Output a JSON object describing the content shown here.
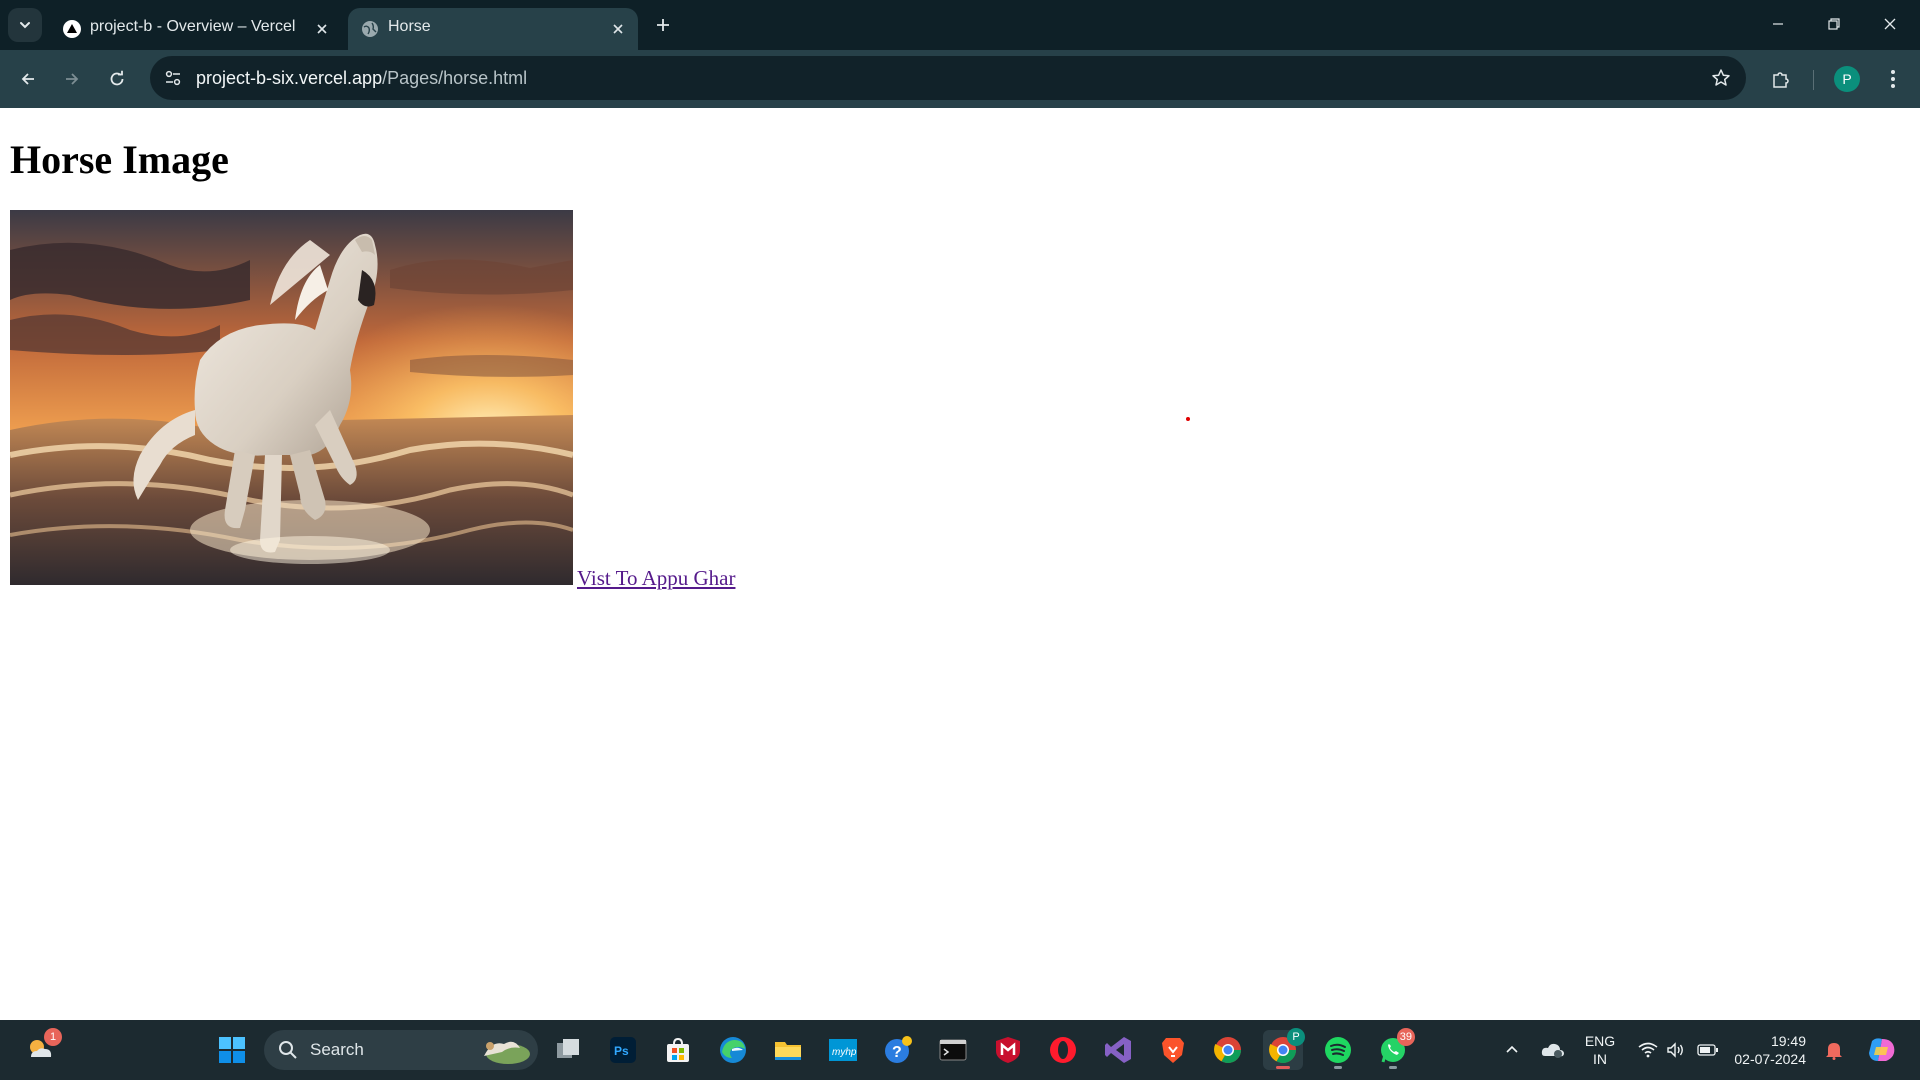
{
  "browser": {
    "tabs": [
      {
        "title": "project-b - Overview – Vercel",
        "favicon": "vercel-triangle-icon",
        "active": false
      },
      {
        "title": "Horse",
        "favicon": "globe-icon",
        "active": true
      }
    ],
    "url_host": "project-b-six.vercel.app",
    "url_path": "/Pages/horse.html",
    "profile_initial": "P"
  },
  "page": {
    "heading": "Horse Image",
    "image_subject": "white horse galloping through ocean waves at sunset",
    "link_text": "Vist To Appu Ghar",
    "link_color": "#551a8b"
  },
  "taskbar": {
    "search_placeholder": "Search",
    "weather_badge": "1",
    "whatsapp_badge": "39",
    "chrome_profile_badge": "P",
    "language_line1": "ENG",
    "language_line2": "IN",
    "time": "19:49",
    "date": "02-07-2024"
  },
  "colors": {
    "titlebar": "#0e2027",
    "toolbar": "#274149",
    "omnibox": "#112229",
    "taskbar": "#1c2a30"
  }
}
